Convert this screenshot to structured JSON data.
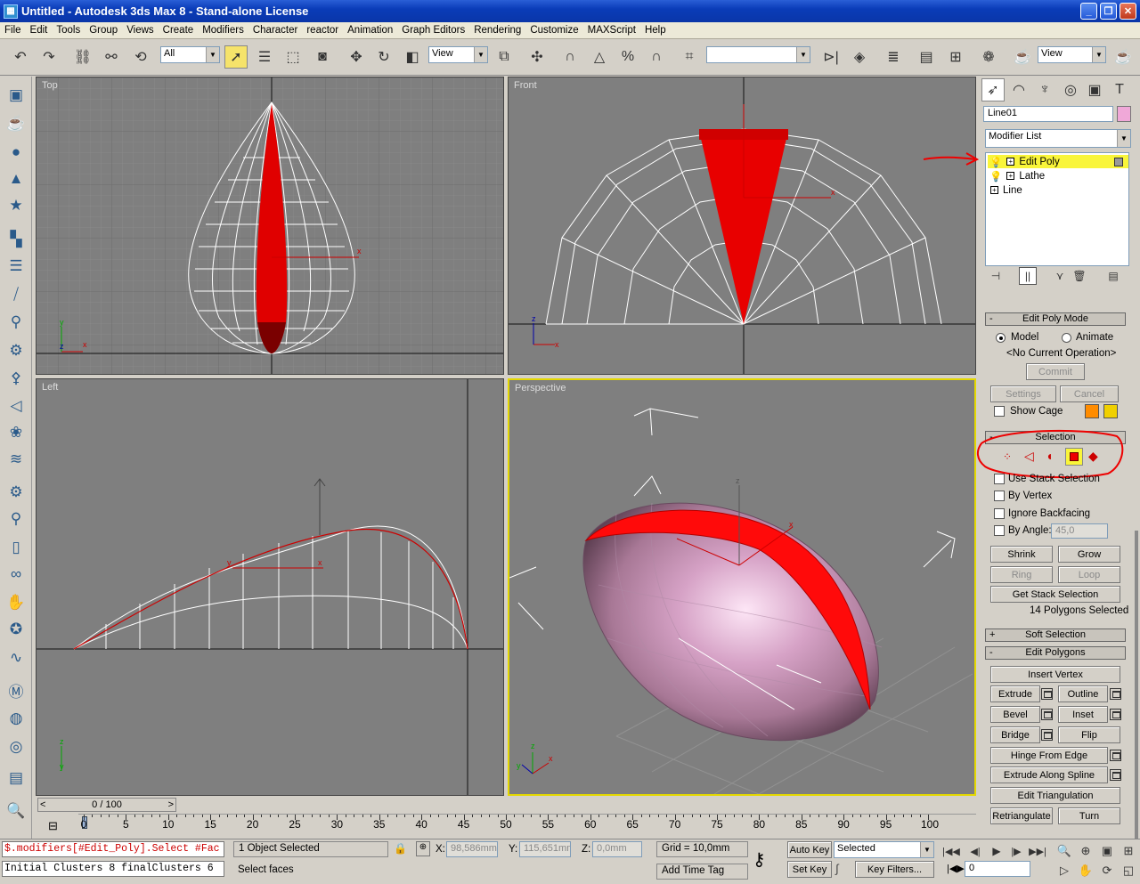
{
  "window": {
    "title": "Untitled - Autodesk 3ds Max 8  - Stand-alone License"
  },
  "menu": [
    "File",
    "Edit",
    "Tools",
    "Group",
    "Views",
    "Create",
    "Modifiers",
    "Character",
    "reactor",
    "Animation",
    "Graph Editors",
    "Rendering",
    "Customize",
    "MAXScript",
    "Help"
  ],
  "toolbar": {
    "selection_filter": "All",
    "ref_coord": "View",
    "named_sel": "",
    "render_view": "View"
  },
  "viewports": {
    "top": "Top",
    "front": "Front",
    "left": "Left",
    "perspective": "Perspective"
  },
  "command_panel": {
    "object_name": "Line01",
    "object_color": "#f0a8d8",
    "modifier_list": "Modifier List",
    "stack": [
      "Edit Poly",
      "Lathe",
      "Line"
    ],
    "edit_poly_mode": {
      "header": "Edit Poly Mode",
      "model": "Model",
      "animate": "Animate",
      "operation": "<No Current Operation>",
      "commit": "Commit",
      "settings": "Settings",
      "cancel": "Cancel",
      "show_cage": "Show Cage"
    },
    "selection": {
      "header": "Selection",
      "use_stack": "Use Stack Selection",
      "by_vertex": "By Vertex",
      "ignore_backfacing": "Ignore Backfacing",
      "by_angle": "By Angle:",
      "angle_value": "45,0",
      "shrink": "Shrink",
      "grow": "Grow",
      "ring": "Ring",
      "loop": "Loop",
      "get_stack": "Get Stack Selection",
      "status": "14 Polygons Selected"
    },
    "soft_selection": "Soft Selection",
    "edit_polygons": {
      "header": "Edit Polygons",
      "insert_vertex": "Insert Vertex",
      "extrude": "Extrude",
      "outline": "Outline",
      "bevel": "Bevel",
      "inset": "Inset",
      "bridge": "Bridge",
      "flip": "Flip",
      "hinge": "Hinge From Edge",
      "extrude_spline": "Extrude Along Spline",
      "edit_tri": "Edit Triangulation",
      "retriangulate": "Retriangulate",
      "turn": "Turn"
    }
  },
  "timeline": {
    "slider": "0 / 100",
    "ticks": [
      "0",
      "5",
      "10",
      "15",
      "20",
      "25",
      "30",
      "35",
      "40",
      "45",
      "50",
      "55",
      "60",
      "65",
      "70",
      "75",
      "80",
      "85",
      "90",
      "95",
      "100"
    ]
  },
  "status": {
    "script_line": "$.modifiers[#Edit_Poly].Select #Fac",
    "listener_line": "Initial Clusters 8 finalClusters 6",
    "selected": "1 Object Selected",
    "prompt": "Select faces",
    "x_label": "X:",
    "x_value": "98,586mm",
    "y_label": "Y:",
    "y_value": "115,651mm",
    "z_label": "Z:",
    "z_value": "0,0mm",
    "grid": "Grid = 10,0mm",
    "add_time_tag": "Add Time Tag",
    "auto_key": "Auto Key",
    "set_key": "Set Key",
    "key_mode": "Selected",
    "key_filters": "Key Filters...",
    "frame": "0"
  }
}
